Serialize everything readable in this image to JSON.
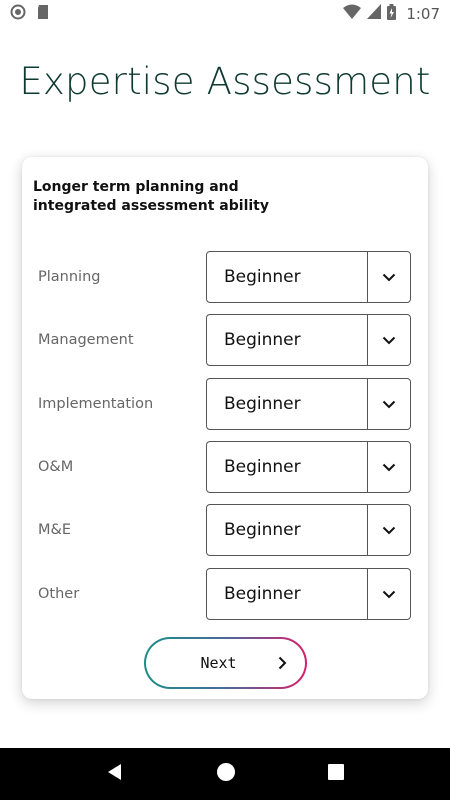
{
  "status_bar": {
    "time": "1:07"
  },
  "page": {
    "title": "Expertise Assessment"
  },
  "card": {
    "heading": "Longer term planning and integrated assessment ability",
    "rows": [
      {
        "label": "Planning",
        "value": "Beginner"
      },
      {
        "label": "Management",
        "value": "Beginner"
      },
      {
        "label": "Implementation",
        "value": "Beginner"
      },
      {
        "label": "O&M",
        "value": "Beginner"
      },
      {
        "label": "M&E",
        "value": "Beginner"
      },
      {
        "label": "Other",
        "value": "Beginner"
      }
    ]
  },
  "next_button": {
    "label": "Next"
  },
  "colors": {
    "title": "#0f3a2f",
    "gradient_start": "#1a8f86",
    "gradient_end": "#d81f6a"
  },
  "icons": {
    "dropdown": "chevron-down-icon",
    "next": "chevron-right-icon"
  }
}
